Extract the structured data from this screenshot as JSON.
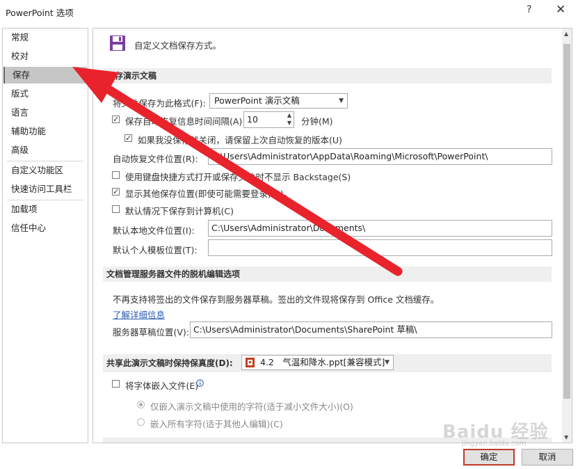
{
  "window": {
    "title": "PowerPoint 选项",
    "help": "?",
    "close": "✕"
  },
  "sidebar": {
    "items": [
      {
        "label": "常规"
      },
      {
        "label": "校对"
      },
      {
        "label": "保存"
      },
      {
        "label": "版式"
      },
      {
        "label": "语言"
      },
      {
        "label": "辅助功能"
      },
      {
        "label": "高级"
      },
      {
        "label": "自定义功能区"
      },
      {
        "label": "快速访问工具栏"
      },
      {
        "label": "加载项"
      },
      {
        "label": "信任中心"
      }
    ],
    "selected": "保存"
  },
  "header": {
    "text": "自定义文档保存方式。"
  },
  "save_section": {
    "title": "保存演示文稿",
    "format_label": "将文件保存为此格式(F):",
    "format_value": "PowerPoint 演示文稿",
    "autorecover_label": "保存自动恢复信息时间间隔(A)",
    "autorecover_value": "10",
    "minutes_label": "分钟(M)",
    "keep_last_label": "如果我没保存就关闭，请保留上次自动恢复的版本(U)",
    "autorecover_location_label": "自动恢复文件位置(R):",
    "autorecover_location_value": "C:\\Users\\Administrator\\AppData\\Roaming\\Microsoft\\PowerPoint\\",
    "no_backstage_label": "使用键盘快捷方式打开或保存文件时不显示 Backstage(S)",
    "show_other_label": "显示其他保存位置(即使可能需要登录)(S)。",
    "default_local_label": "默认情况下保存到计算机(C)",
    "default_local_location_label": "默认本地文件位置(I):",
    "default_local_location_value": "C:\\Users\\Administrator\\Documents\\",
    "personal_templates_label": "默认个人模板位置(T):",
    "personal_templates_value": ""
  },
  "offline_section": {
    "title": "文档管理服务器文件的脱机编辑选项",
    "note": "不再支持将签出的文件保存到服务器草稿。签出的文件现将保存到 Office 文档缓存。",
    "learn_more": "了解详细信息",
    "drafts_label": "服务器草稿位置(V):",
    "drafts_value": "C:\\Users\\Administrator\\Documents\\SharePoint 草稿\\"
  },
  "fidelity_section": {
    "title": "共享此演示文稿时保持保真度(D):",
    "file_value": "4.2　气温和降水.ppt[兼容模式]",
    "embed_fonts_label": "将字体嵌入文件(E)",
    "embed_used_label": "仅嵌入演示文稿中使用的字符(适于减小文件大小)(O)",
    "embed_all_label": "嵌入所有字符(适于其他人编辑)(C)"
  },
  "buttons": {
    "ok": "确定",
    "cancel": "取消"
  },
  "watermark": {
    "text": "Baidu 经验",
    "sub": "jingyan.baidu.com"
  },
  "colors": {
    "accent_purple": "#7a3fa0",
    "arrow_red": "#e8232b",
    "selected_bg": "#c6c6c6"
  }
}
